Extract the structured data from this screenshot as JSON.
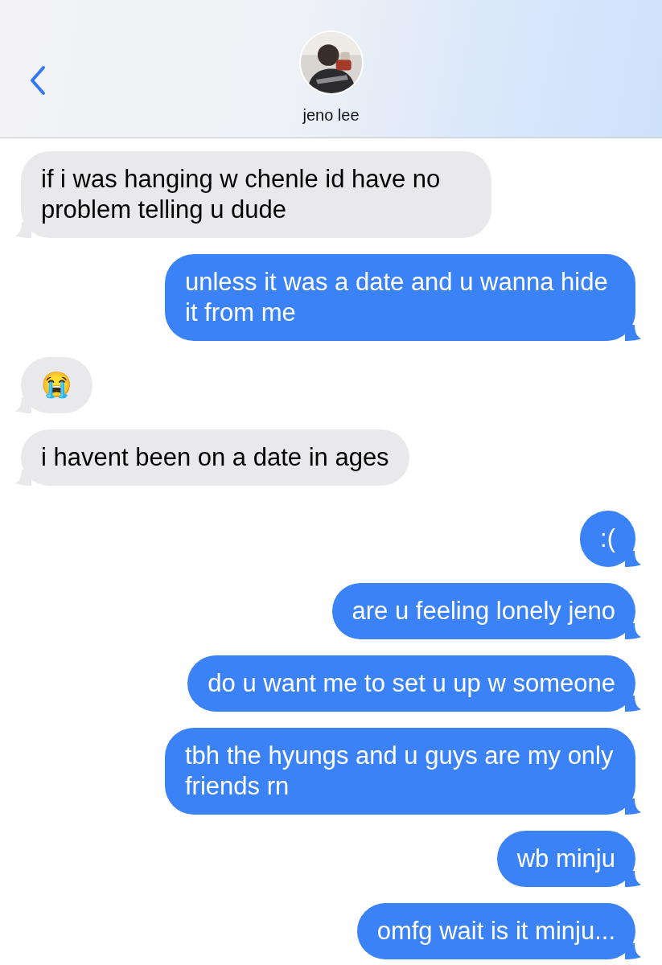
{
  "header": {
    "contact_name": "jeno lee"
  },
  "messages": [
    {
      "kind": "received",
      "text": "if i was hanging w chenle id have no problem telling u dude"
    },
    {
      "kind": "sent",
      "text": "unless it was a date and u wanna hide it from me"
    },
    {
      "kind": "received",
      "text": "😭"
    },
    {
      "kind": "received",
      "text": "i havent been on a date in ages"
    },
    {
      "kind": "sent",
      "text": ":("
    },
    {
      "kind": "sent",
      "text": "are u feeling lonely jeno"
    },
    {
      "kind": "sent",
      "text": "do u want me to set u up w someone"
    },
    {
      "kind": "sent",
      "text": "tbh the hyungs and u guys are my only friends rn"
    },
    {
      "kind": "sent",
      "text": "wb minju"
    },
    {
      "kind": "sent",
      "text": "omfg wait is it minju..."
    }
  ]
}
